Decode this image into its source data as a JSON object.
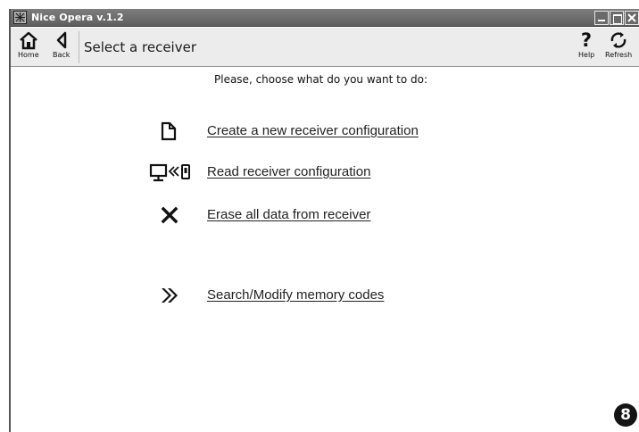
{
  "window": {
    "title": "Nice Opera v.1.2"
  },
  "toolbar": {
    "home_label": "Home",
    "back_label": "Back",
    "page_title": "Select a receiver",
    "help_label": "Help",
    "refresh_label": "Refresh"
  },
  "main": {
    "prompt": "Please, choose what do you want to do:",
    "actions": [
      {
        "icon": "new-document-icon",
        "label": "Create a new receiver configuration"
      },
      {
        "icon": "read-from-receiver-icon",
        "label": "Read receiver configuration"
      },
      {
        "icon": "erase-x-icon",
        "label": "Erase all data from receiver"
      },
      {
        "icon": "double-arrow-icon",
        "label": "Search/Modify memory codes"
      }
    ]
  },
  "badge": "8"
}
